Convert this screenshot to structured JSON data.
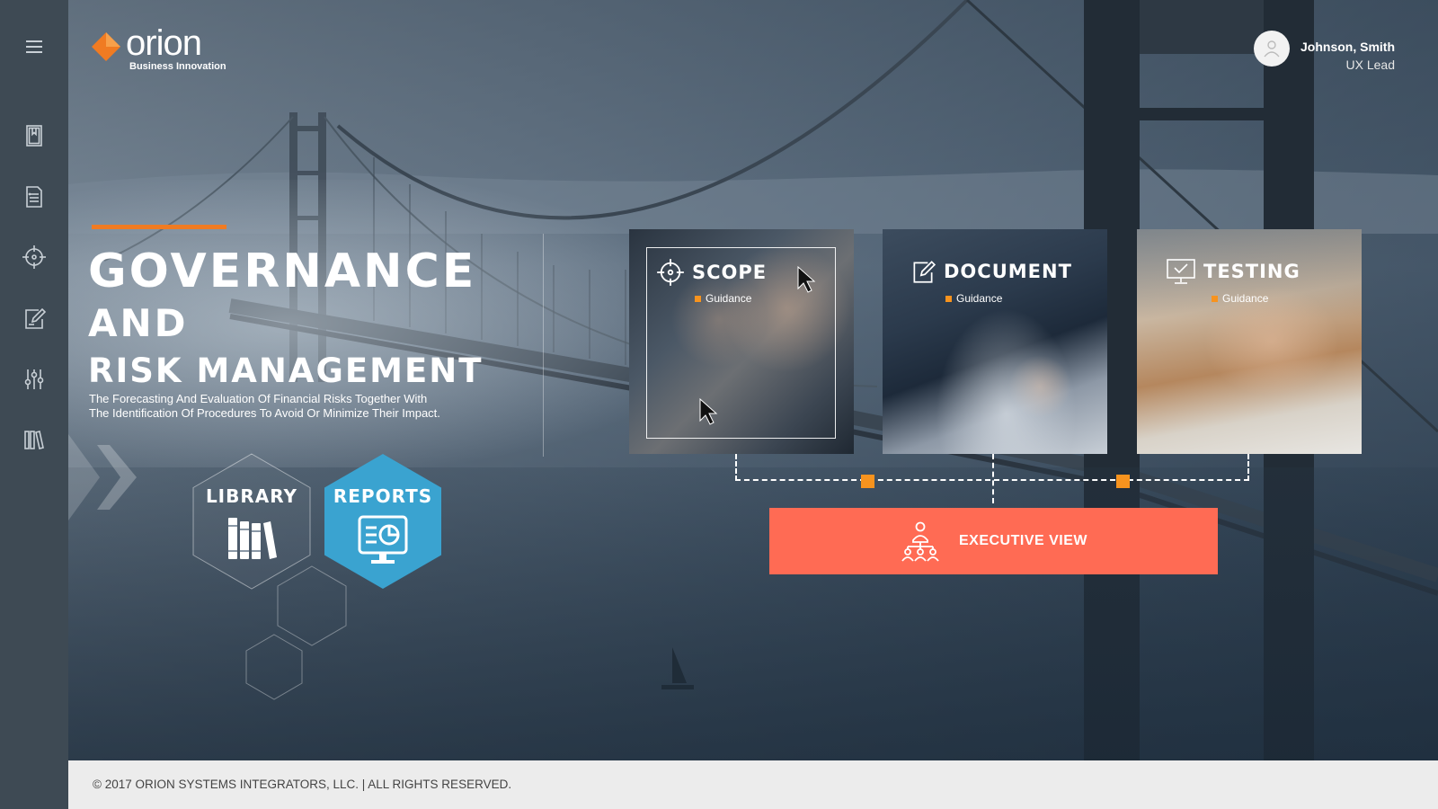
{
  "brand": {
    "name": "orion",
    "tagline": "Business Innovation",
    "accent_color": "#f07b22"
  },
  "user": {
    "name": "Johnson, Smith",
    "role": "UX Lead"
  },
  "sidebar": {
    "items": [
      {
        "name": "menu",
        "icon": "hamburger-icon"
      },
      {
        "name": "bookmark",
        "icon": "bookmark-icon"
      },
      {
        "name": "document-list",
        "icon": "document-list-icon"
      },
      {
        "name": "scope",
        "icon": "crosshair-icon"
      },
      {
        "name": "edit",
        "icon": "edit-icon"
      },
      {
        "name": "settings",
        "icon": "sliders-icon"
      },
      {
        "name": "library",
        "icon": "library-icon"
      }
    ]
  },
  "hero": {
    "title_line1": "GOVERNANCE",
    "title_line2": "AND",
    "title_line3": "RISK MANAGEMENT",
    "description_line1": "The Forecasting And Evaluation Of Financial Risks Together With",
    "description_line2": "The Identification Of Procedures To Avoid Or Minimize Their Impact."
  },
  "hex_buttons": {
    "library": {
      "label": "LIBRARY",
      "icon": "books-icon"
    },
    "reports": {
      "label": "REPORTS",
      "icon": "monitor-report-icon",
      "color": "#3aa3d0"
    }
  },
  "cards": [
    {
      "title": "SCOPE",
      "subtitle": "Guidance",
      "icon": "crosshair-icon"
    },
    {
      "title": "DOCUMENT",
      "subtitle": "Guidance",
      "icon": "edit-icon"
    },
    {
      "title": "TESTING",
      "subtitle": "Guidance",
      "icon": "monitor-check-icon"
    }
  ],
  "executive": {
    "label": "EXECUTIVE VIEW",
    "icon": "org-hierarchy-icon",
    "color": "#ff6b54"
  },
  "footer": {
    "copyright": "© 2017 ORION SYSTEMS INTEGRATORS, LLC. | ALL RIGHTS RESERVED."
  }
}
